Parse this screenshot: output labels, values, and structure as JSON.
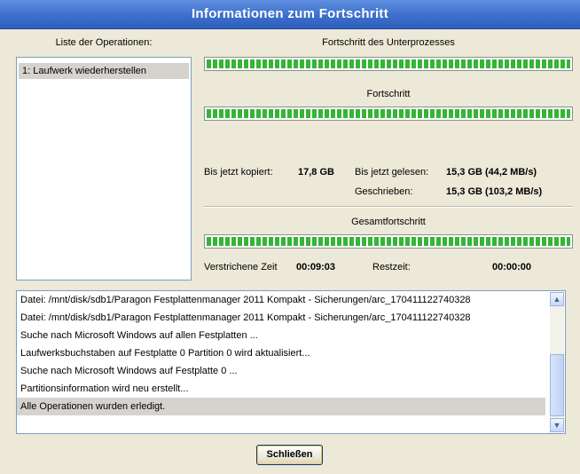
{
  "window": {
    "title": "Informationen zum Fortschritt"
  },
  "operations": {
    "header": "Liste der Operationen:",
    "items": [
      "1: Laufwerk wiederherstellen"
    ]
  },
  "progress": {
    "subprocess_header": "Fortschritt des Unterprozesses",
    "subprocess_value": 1.0,
    "progress_header": "Fortschritt",
    "progress_value": 1.0,
    "total_header": "Gesamtfortschritt",
    "total_value": 1.0
  },
  "stats": {
    "copied_label": "Bis jetzt kopiert:",
    "copied_value": "17,8 GB",
    "read_label": "Bis jetzt gelesen:",
    "read_value": "15,3 GB (44,2 MB/s)",
    "written_label": "Geschrieben:",
    "written_value": "15,3 GB (103,2 MB/s)",
    "elapsed_label": "Verstrichene Zeit",
    "elapsed_value": "00:09:03",
    "remaining_label": "Restzeit:",
    "remaining_value": "00:00:00"
  },
  "log": {
    "lines": [
      "Datei: /mnt/disk/sdb1/Paragon Festplattenmanager 2011 Kompakt - Sicherungen/arc_170411122740328",
      "Datei: /mnt/disk/sdb1/Paragon Festplattenmanager 2011 Kompakt - Sicherungen/arc_170411122740328",
      "Suche nach Microsoft Windows auf allen Festplatten ...",
      "Laufwerksbuchstaben auf Festplatte 0 Partition 0 wird aktualisiert...",
      "Suche nach Microsoft Windows auf Festplatte 0 ...",
      "Partitionsinformation wird neu erstellt...",
      "Alle Operationen wurden erledigt."
    ],
    "selected_index": 6
  },
  "buttons": {
    "close_label": "Schließen"
  },
  "icons": {
    "scroll_up": "chevron-up-icon",
    "scroll_down": "chevron-down-icon"
  }
}
